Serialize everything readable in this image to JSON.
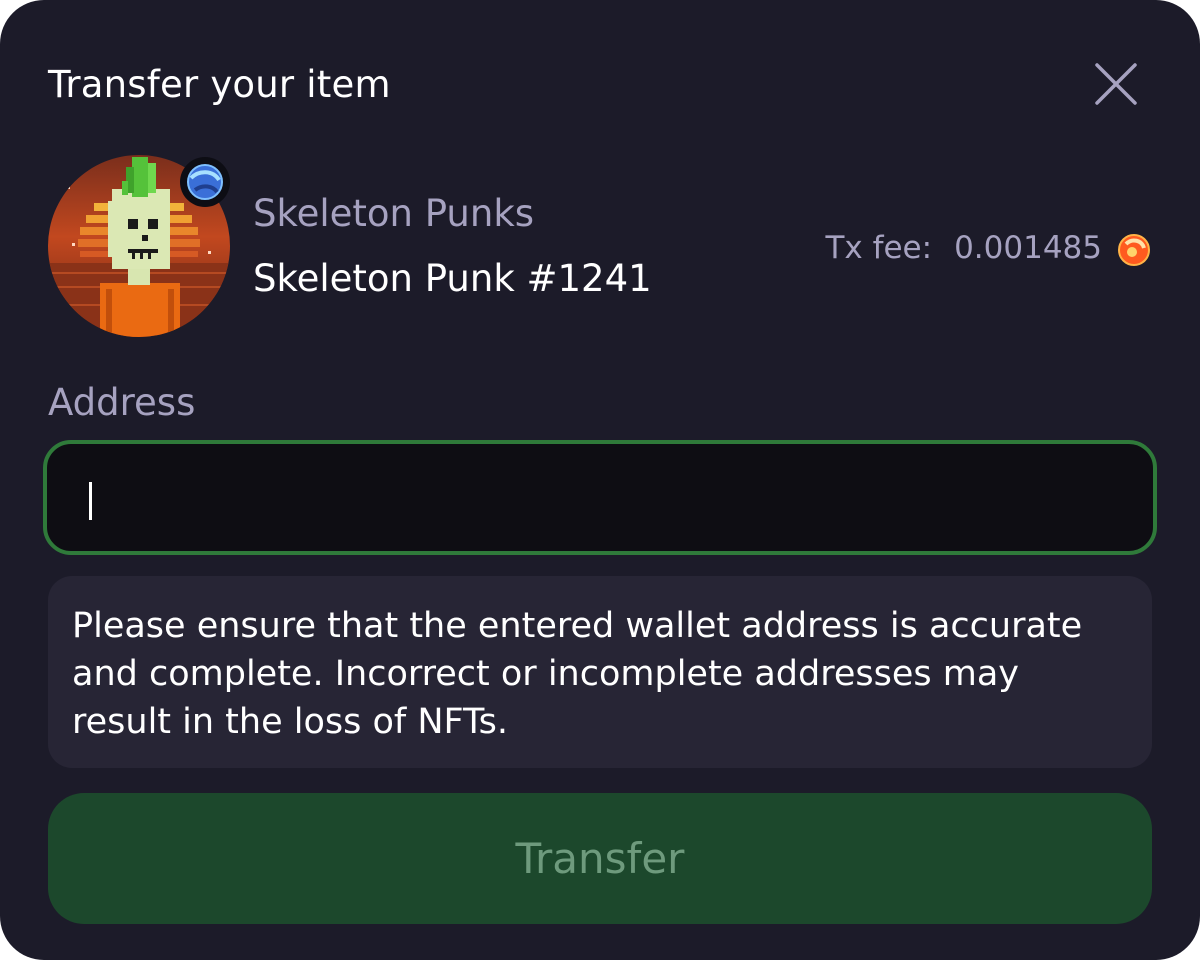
{
  "dialog": {
    "title": "Transfer your item",
    "close_icon": "close-icon"
  },
  "item": {
    "collection": "Skeleton Punks",
    "name": "Skeleton Punk #1241",
    "chain_icon": "chain-badge-icon"
  },
  "fee": {
    "label": "Tx fee:",
    "value": "0.001485",
    "token_icon": "token-icon"
  },
  "address": {
    "label": "Address",
    "value": "",
    "placeholder": ""
  },
  "warning": {
    "text": "Please ensure that the entered wallet address is accurate and complete. Incorrect or incomplete addresses may result in the loss of NFTs."
  },
  "actions": {
    "transfer_label": "Transfer"
  },
  "colors": {
    "background": "#1c1b29",
    "accent_green": "#2f7a3a",
    "button_green": "#1c482c",
    "muted_text": "#a6a2c0"
  }
}
